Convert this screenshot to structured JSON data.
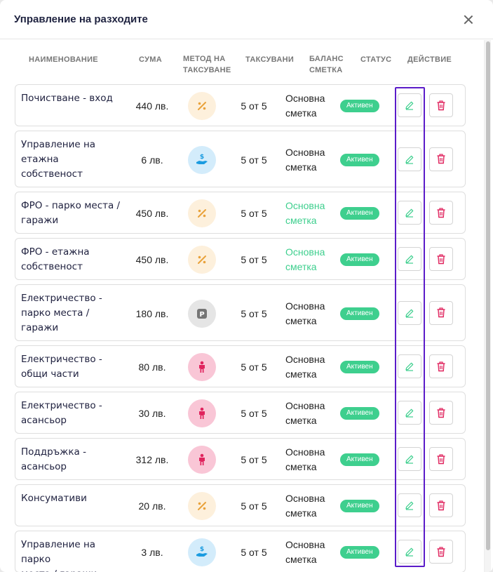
{
  "modal": {
    "title": "Управление на разходите"
  },
  "columns": {
    "name": "НАИМЕНОВАНИЕ",
    "amount": "СУМА",
    "method_l1": "МЕТОД НА",
    "method_l2": "ТАКСУВАНЕ",
    "taxed": "ТАКСУВАНИ",
    "balance_l1": "БАЛАНС",
    "balance_l2": "СМЕТКА",
    "status": "СТАТУС",
    "action": "ДЕЙСТВИЕ"
  },
  "colors": {
    "status_active": "#3ecf8e",
    "account_green": "#3ecf8e",
    "edit_icon": "#3ecf8e",
    "delete_icon": "#e0245e",
    "highlight": "#5b1cc9"
  },
  "rows": [
    {
      "name_lines": [
        "Почистване - вход"
      ],
      "amount": "440 лв.",
      "method_icon": "percent-icon",
      "taxed": "5 от 5",
      "account_lines": [
        "Основна",
        "сметка"
      ],
      "account_green": false,
      "status": "Активен"
    },
    {
      "name_lines": [
        "Управление на",
        "етажна",
        "собственост"
      ],
      "amount": "6 лв.",
      "method_icon": "hand-money-icon",
      "taxed": "5 от 5",
      "account_lines": [
        "Основна",
        "сметка"
      ],
      "account_green": false,
      "status": "Активен"
    },
    {
      "name_lines": [
        "ФРО - парко места /",
        "гаражи"
      ],
      "amount": "450 лв.",
      "method_icon": "percent-icon",
      "taxed": "5 от 5",
      "account_lines": [
        "Основна",
        "сметка"
      ],
      "account_green": true,
      "status": "Активен"
    },
    {
      "name_lines": [
        "ФРО - етажна",
        "собственост"
      ],
      "amount": "450 лв.",
      "method_icon": "percent-icon",
      "taxed": "5 от 5",
      "account_lines": [
        "Основна",
        "сметка"
      ],
      "account_green": true,
      "status": "Активен"
    },
    {
      "name_lines": [
        "Електричество -",
        "парко места /",
        "гаражи"
      ],
      "amount": "180 лв.",
      "method_icon": "parking-icon",
      "taxed": "5 от 5",
      "account_lines": [
        "Основна",
        "сметка"
      ],
      "account_green": false,
      "status": "Активен"
    },
    {
      "name_lines": [
        "Електричество -",
        "общи части"
      ],
      "amount": "80 лв.",
      "method_icon": "person-icon",
      "taxed": "5 от 5",
      "account_lines": [
        "Основна",
        "сметка"
      ],
      "account_green": false,
      "status": "Активен"
    },
    {
      "name_lines": [
        "Електричество -",
        "асансьор"
      ],
      "amount": "30 лв.",
      "method_icon": "person-icon",
      "taxed": "5 от 5",
      "account_lines": [
        "Основна",
        "сметка"
      ],
      "account_green": false,
      "status": "Активен"
    },
    {
      "name_lines": [
        "Поддръжка -",
        "асансьор"
      ],
      "amount": "312 лв.",
      "method_icon": "person-icon",
      "taxed": "5 от 5",
      "account_lines": [
        "Основна",
        "сметка"
      ],
      "account_green": false,
      "status": "Активен"
    },
    {
      "name_lines": [
        "Консумативи"
      ],
      "amount": "20 лв.",
      "method_icon": "percent-icon",
      "taxed": "5 от 5",
      "account_lines": [
        "Основна",
        "сметка"
      ],
      "account_green": false,
      "status": "Активен"
    },
    {
      "name_lines": [
        "Управление на парко",
        "места / гаражи"
      ],
      "amount": "3 лв.",
      "method_icon": "hand-money-icon",
      "taxed": "5 от 5",
      "account_lines": [
        "Основна",
        "сметка"
      ],
      "account_green": false,
      "status": "Активен"
    }
  ]
}
